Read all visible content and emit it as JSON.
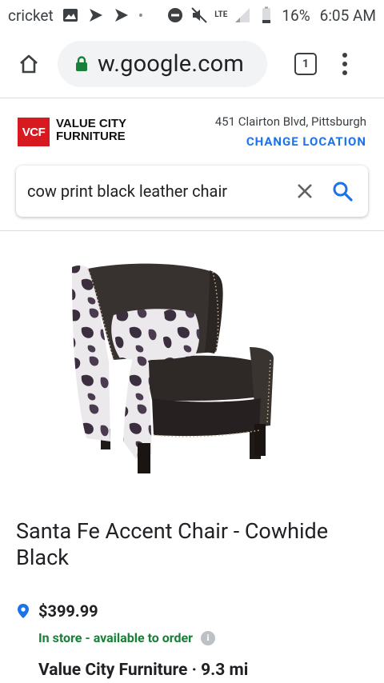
{
  "status_bar": {
    "carrier": "cricket",
    "network": "LTE",
    "battery": "16%",
    "time": "6:05 AM"
  },
  "browser": {
    "url": "w.google.com",
    "tab_count": "1"
  },
  "store": {
    "logo_text": "VCF",
    "name_line1": "VALUE CITY",
    "name_line2": "FURNITURE",
    "address": "451 Clairton Blvd, Pittsburgh",
    "change_location": "CHANGE LOCATION"
  },
  "search": {
    "query": "cow print black leather chair"
  },
  "product": {
    "title": "Santa Fe Accent Chair - Cowhide Black",
    "price": "$399.99",
    "availability": "In store - available to order",
    "info_symbol": "i",
    "store_distance": "Value City Furniture · 9.3 mi"
  },
  "colors": {
    "accent": "#1a73e8",
    "brand_red": "#d71920",
    "availability_green": "#188038"
  }
}
